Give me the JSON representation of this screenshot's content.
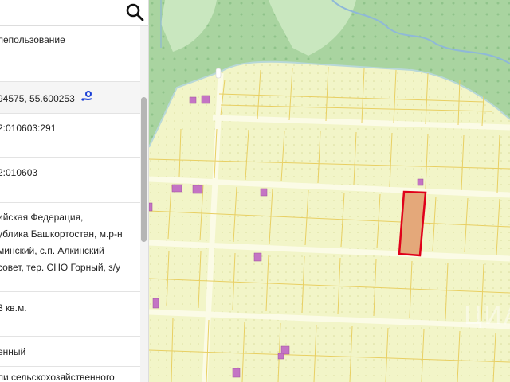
{
  "search": {
    "icon": "search-icon"
  },
  "panel": {
    "rows": [
      {
        "text": "лепользование",
        "extra": ""
      },
      {
        "text": "94575, 55.600253",
        "extra": ""
      },
      {
        "text": "2:010603:291",
        "extra": ""
      },
      {
        "text": "2:010603",
        "extra": ""
      },
      {
        "text": "ийская Федерация,",
        "extra": ""
      },
      {
        "text": "ублика Башкортостан, м.р-н",
        "extra": ""
      },
      {
        "text": "минский, с.п. Алкинский",
        "extra": ""
      },
      {
        "text": "совет, тер. СНО Горный, з/у",
        "extra": ""
      },
      {
        "text": "3 кв.м.",
        "extra": ""
      },
      {
        "text": "енный",
        "extra": ""
      },
      {
        "text": "ли сельскохозяйственного",
        "extra": ""
      }
    ]
  },
  "map": {
    "colors": {
      "forest": "#a9d4a0",
      "field": "#f2f5c8",
      "roads": "#fafae0",
      "plot_border": "#e8cf62",
      "building": "#c474c4",
      "selected_fill": "#e4a87a",
      "selected_border": "#e0001a",
      "river": "#8fb8d8"
    },
    "watermark": "ЦИАН"
  }
}
